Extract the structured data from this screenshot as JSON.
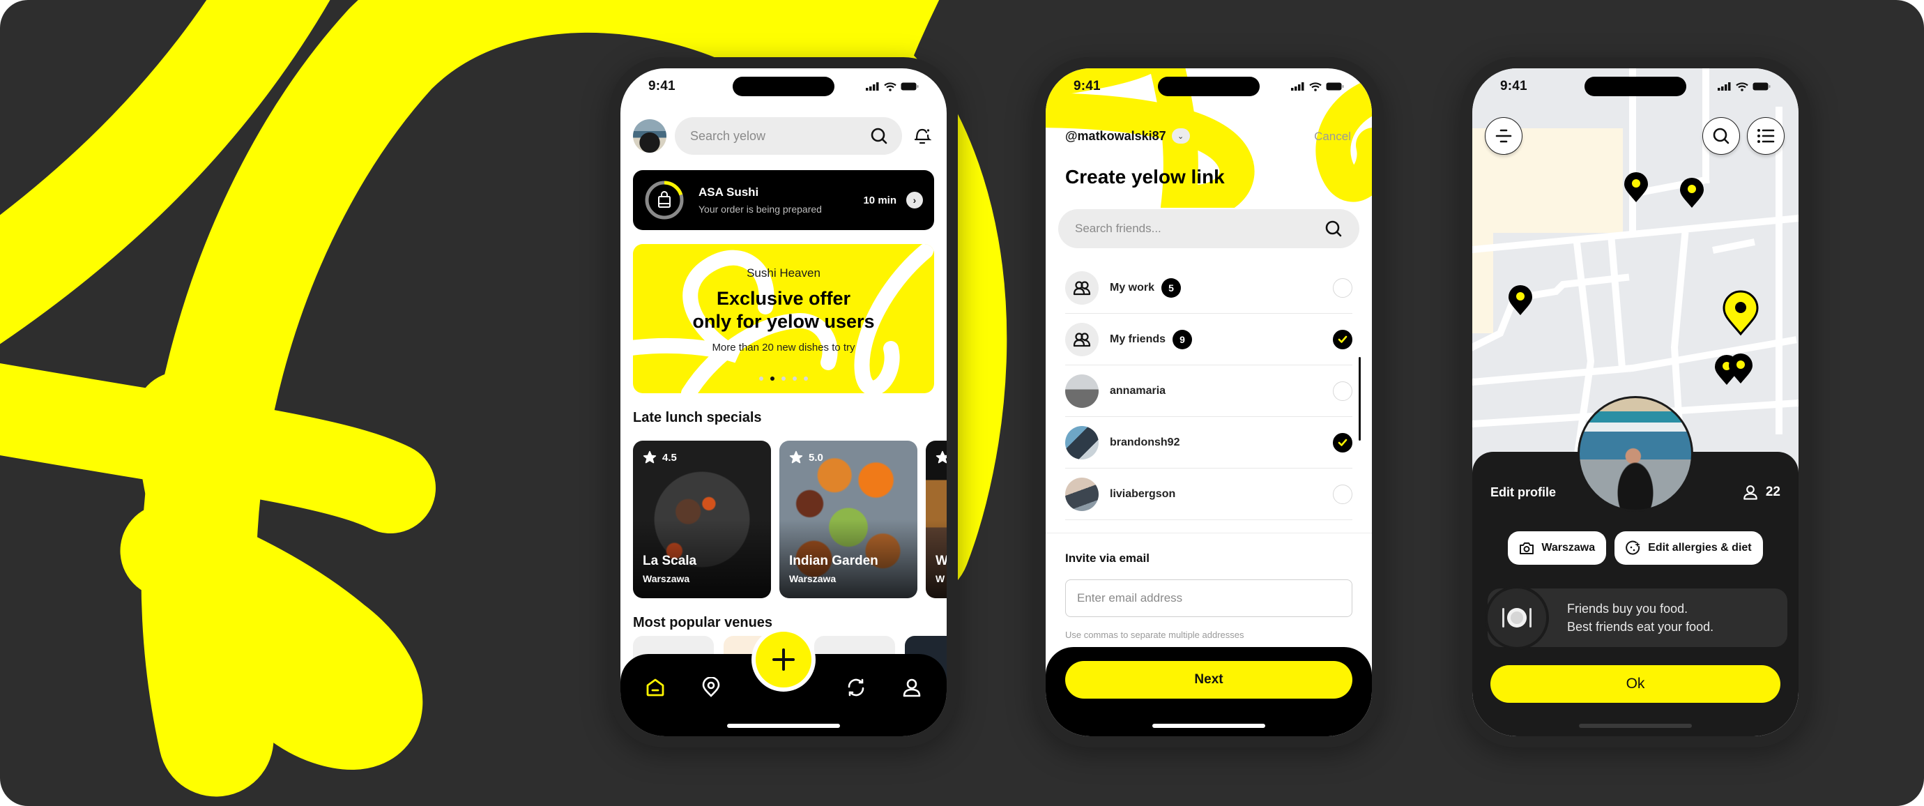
{
  "theme": {
    "accent": "#fff500",
    "background": "#2e2e2e",
    "dark": "#000000"
  },
  "status_bar": {
    "time": "9:41",
    "icons": [
      "signal-icon",
      "wifi-icon",
      "battery-icon"
    ]
  },
  "home_screen": {
    "search": {
      "placeholder": "Search yelow",
      "icon": "search-icon"
    },
    "notification_icon": "bell-icon",
    "order": {
      "venue": "ASA Sushi",
      "status": "Your order is being prepared",
      "eta": "10 min",
      "progress": 0.2
    },
    "promo": {
      "venue": "Sushi Heaven",
      "headline_line1": "Exclusive offer",
      "headline_line2": "only for yelow users",
      "subtitle": "More than 20 new dishes to try",
      "carousel_total": 5,
      "carousel_active": 2
    },
    "late_lunch": {
      "title": "Late lunch specials",
      "cards": [
        {
          "rating": "4.5",
          "name": "La Scala",
          "city": "Warszawa"
        },
        {
          "rating": "5.0",
          "name": "Indian Garden",
          "city": "Warszawa"
        },
        {
          "rating": "",
          "name": "W",
          "city": "W"
        }
      ]
    },
    "popular": {
      "title": "Most popular venues"
    },
    "tab_bar": {
      "items": [
        "home",
        "map",
        "add",
        "exchange",
        "profile"
      ],
      "active": "home"
    }
  },
  "link_screen": {
    "handle": "@matkowalski87",
    "cancel": "Cancel",
    "title": "Create yelow link",
    "search_placeholder": "Search friends...",
    "rows": [
      {
        "type": "group",
        "name": "My work",
        "count": "5",
        "checked": false
      },
      {
        "type": "group",
        "name": "My friends",
        "count": "9",
        "checked": true
      },
      {
        "type": "user",
        "name": "annamaria",
        "checked": false
      },
      {
        "type": "user",
        "name": "brandonsh92",
        "checked": true
      },
      {
        "type": "user",
        "name": "liviabergson",
        "checked": false
      }
    ],
    "invite": {
      "label": "Invite via email",
      "placeholder": "Enter email address",
      "value": "",
      "hint": "Use commas to separate multiple addresses"
    },
    "next_label": "Next"
  },
  "profile_screen": {
    "edit_profile": "Edit profile",
    "followers": "22",
    "chips": [
      {
        "icon": "camera-icon",
        "label": "Warszawa"
      },
      {
        "icon": "diet-icon",
        "label": "Edit allergies & diet"
      }
    ],
    "tip_line1": "Friends buy you food.",
    "tip_line2": "Best friends eat your food.",
    "ok_label": "Ok"
  }
}
